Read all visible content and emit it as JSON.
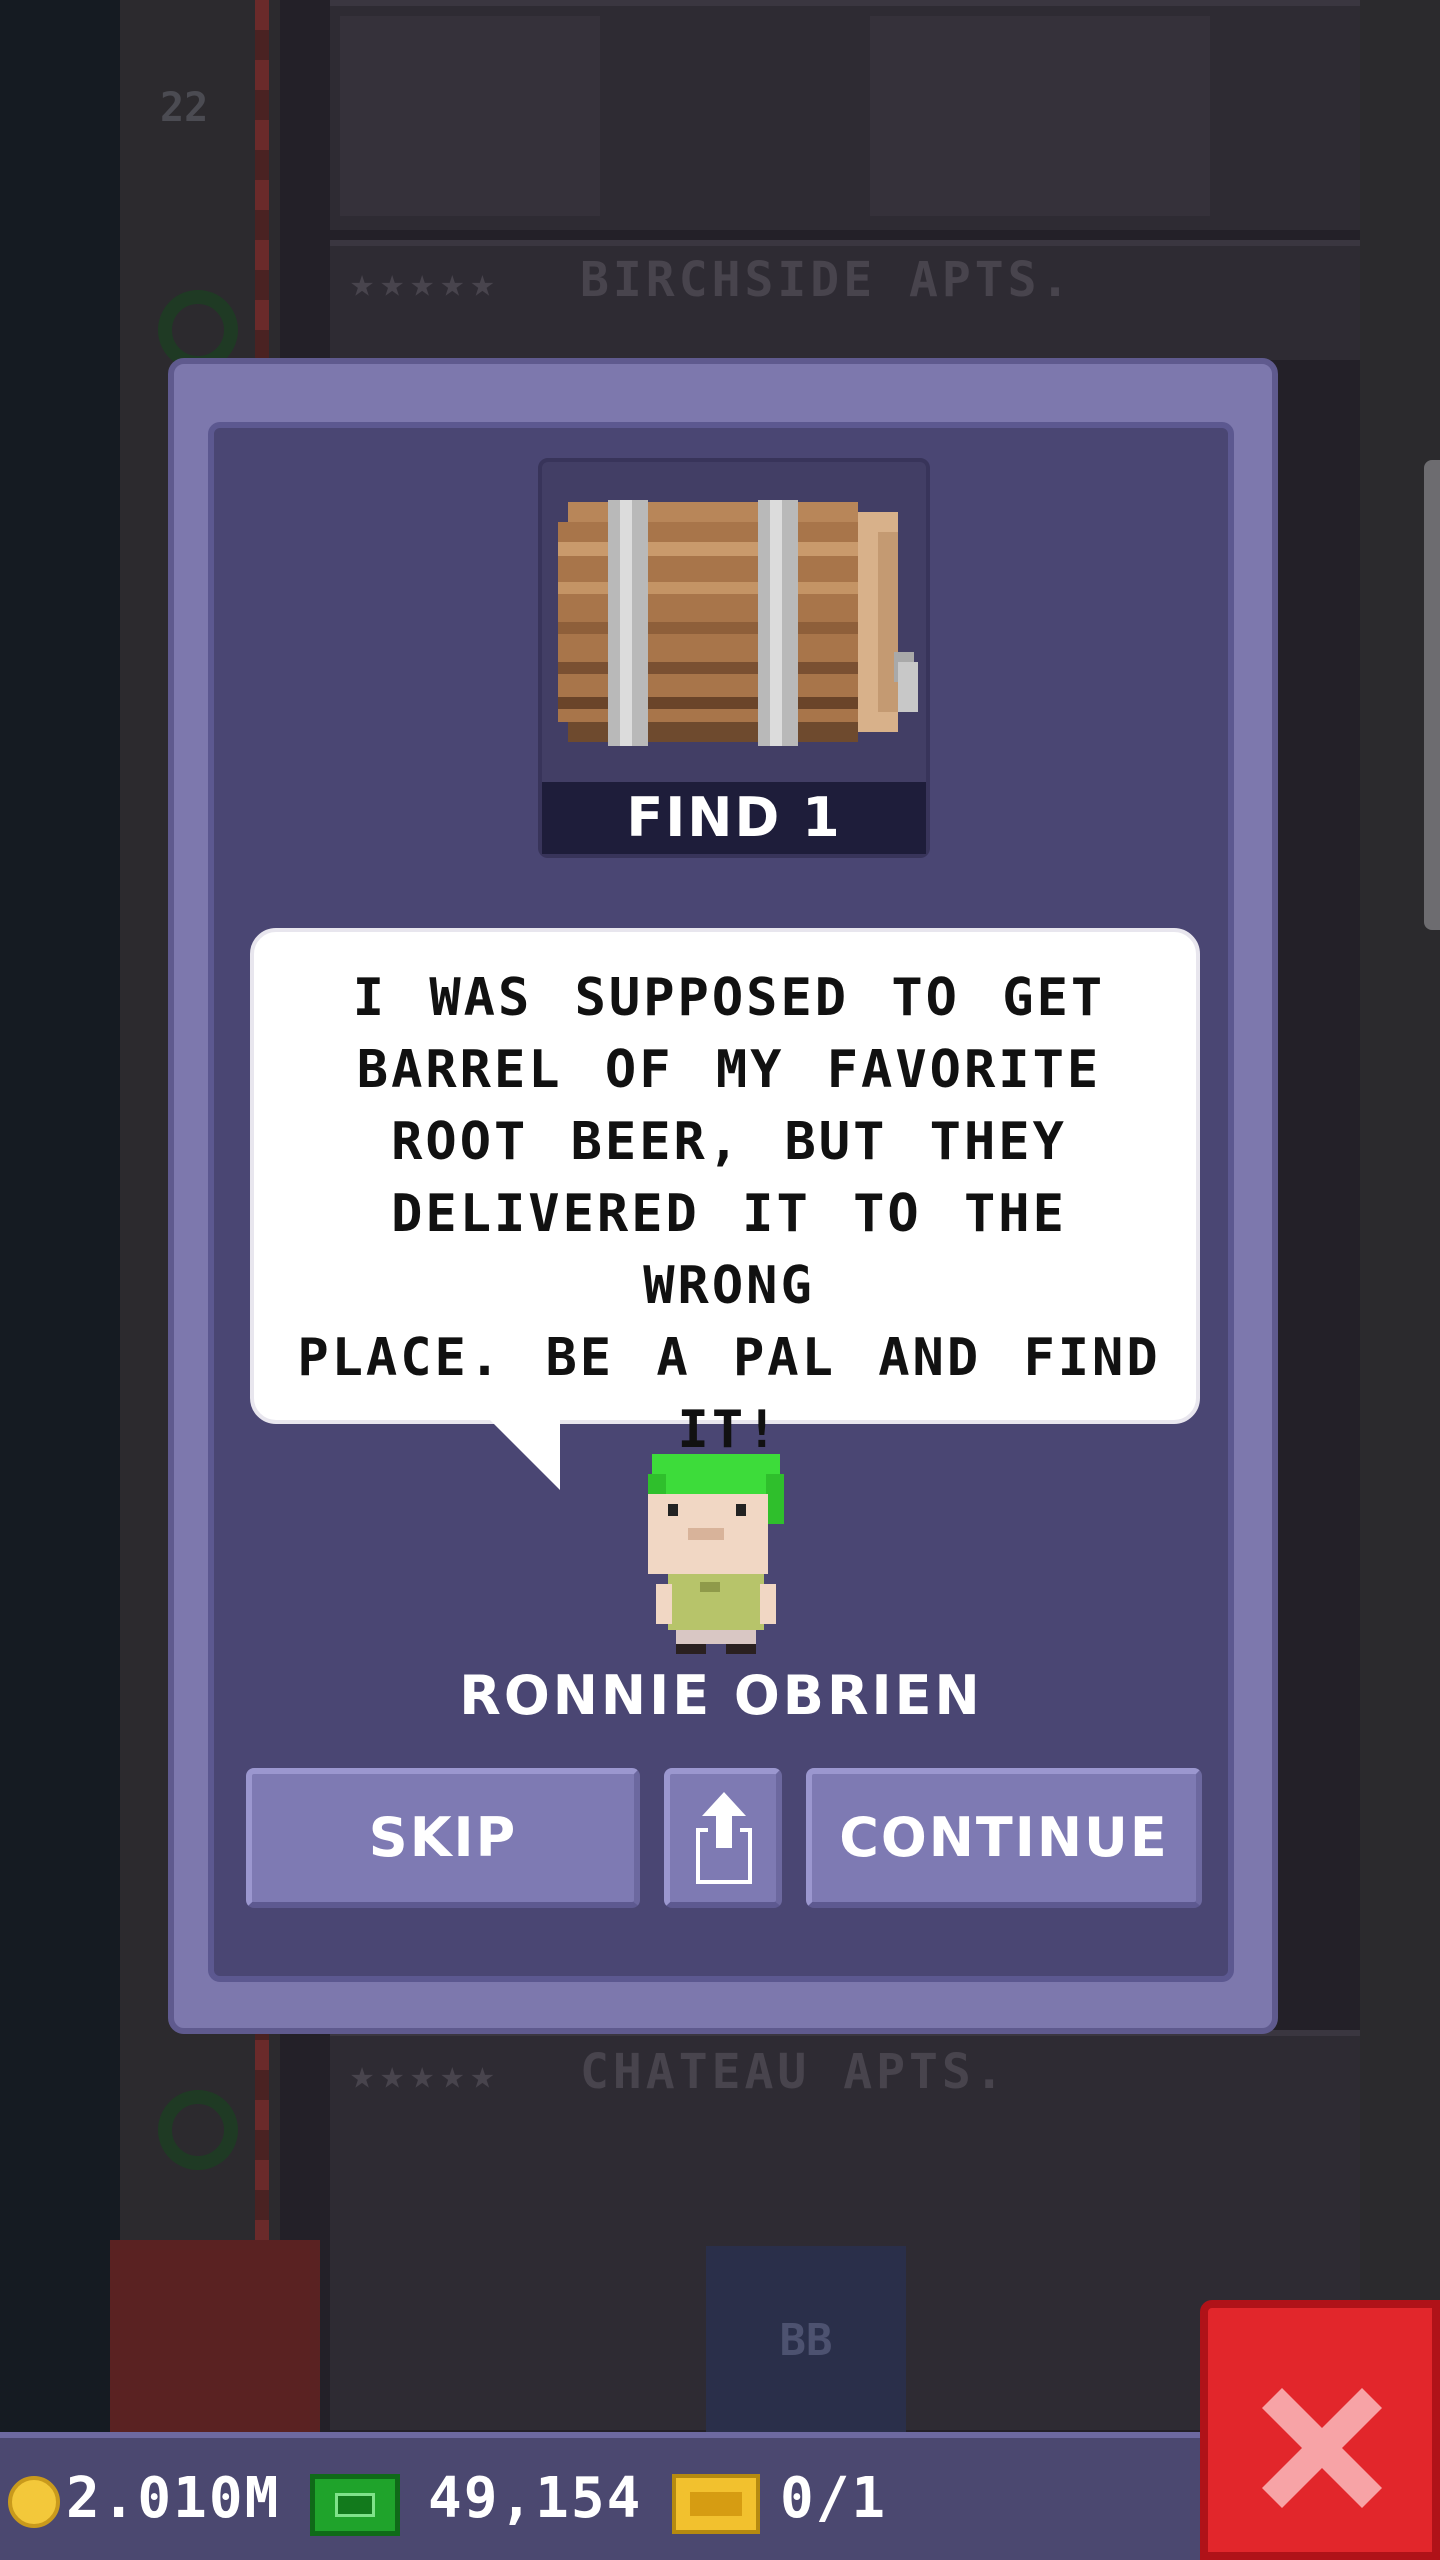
{
  "background": {
    "floor_number": "22",
    "floors": [
      {
        "name": "BIRCHSIDE APTS.",
        "rating": "★★★★★"
      },
      {
        "name": "CHATEAU APTS.",
        "rating": "★★★★★"
      }
    ],
    "room_sign": "BB"
  },
  "mission_dialog": {
    "item": {
      "icon": "root-beer-barrel-icon",
      "find_label": "FIND 1"
    },
    "speech": "I WAS SUPPOSED TO GET BARREL OF MY FAVORITE ROOT BEER, BUT THEY DELIVERED IT TO THE WRONG PLACE. BE A PAL AND FIND IT!",
    "speech_lines": [
      "I WAS SUPPOSED TO GET",
      "BARREL OF MY FAVORITE",
      "ROOT BEER, BUT THEY",
      "DELIVERED IT TO THE WRONG",
      "PLACE. BE A PAL AND FIND",
      "IT!"
    ],
    "character_name": "RONNIE OBRIEN",
    "buttons": {
      "skip": "SKIP",
      "share_icon": "share-icon",
      "continue": "CONTINUE"
    }
  },
  "status_bar": {
    "coins": "2.010M",
    "bux": "49,154",
    "tickets": "0/1"
  },
  "close_button": {
    "icon": "close-x-icon"
  },
  "colors": {
    "dialog_border": "#7d78ad",
    "dialog_inner": "#4a4673",
    "button": "#7e7ab3",
    "close_red": "#e2262b",
    "character_hair": "#3ddc3a",
    "character_shirt": "#b7c46a"
  }
}
